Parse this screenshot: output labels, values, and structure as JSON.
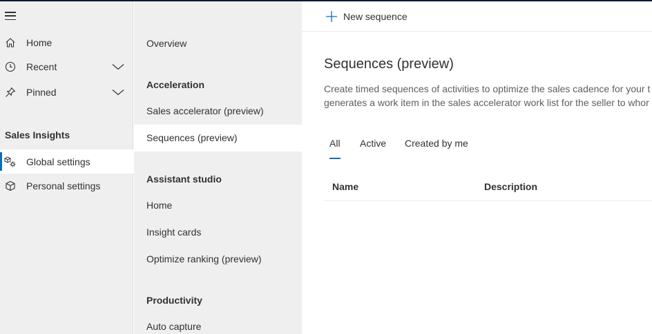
{
  "leftnav": {
    "items": [
      {
        "label": "Home",
        "icon": "home-icon"
      },
      {
        "label": "Recent",
        "icon": "clock-icon"
      },
      {
        "label": "Pinned",
        "icon": "pin-icon"
      }
    ],
    "section_title": "Sales Insights",
    "settings_items": [
      {
        "label": "Global settings",
        "icon": "global-settings-icon",
        "selected": true
      },
      {
        "label": "Personal settings",
        "icon": "cube-icon",
        "selected": false
      }
    ]
  },
  "subnav": {
    "overview": "Overview",
    "groups": [
      {
        "heading": "Acceleration",
        "items": [
          "Sales accelerator (preview)",
          "Sequences (preview)"
        ]
      },
      {
        "heading": "Assistant studio",
        "items": [
          "Home",
          "Insight cards",
          "Optimize ranking (preview)"
        ]
      },
      {
        "heading": "Productivity",
        "items": [
          "Auto capture"
        ]
      }
    ],
    "selected": "Sequences (preview)"
  },
  "main": {
    "command_bar": {
      "new_label": "New sequence"
    },
    "title": "Sequences (preview)",
    "description_line1": "Create timed sequences of activities to optimize the sales cadence for your t",
    "description_line2": "generates a work item in the sales accelerator work list for the seller to whor",
    "tabs": [
      "All",
      "Active",
      "Created by me"
    ],
    "active_tab": "All",
    "columns": [
      "Name",
      "Description"
    ]
  },
  "colors": {
    "accent": "#0f6cbd",
    "nav_bg": "#efefef",
    "text": "#323130"
  }
}
